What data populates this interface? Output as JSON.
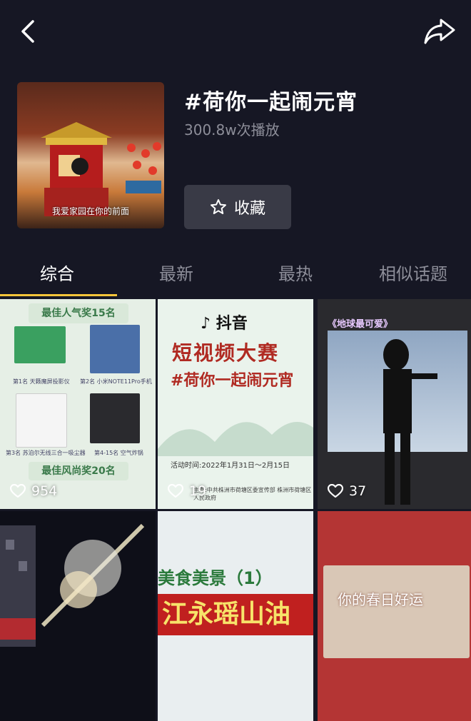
{
  "header": {
    "title": "#荷你一起闹元宵",
    "plays": "300.8w次播放",
    "cover_caption": "我爱家园在你的前面",
    "favorite_label": "收藏"
  },
  "icons": {
    "back": "chevron-left-icon",
    "share": "share-arrow-icon",
    "favorite": "star-outline-icon",
    "like": "heart-outline-icon"
  },
  "tabs": [
    {
      "label": "综合",
      "active": true
    },
    {
      "label": "最新",
      "active": false
    },
    {
      "label": "最热",
      "active": false
    },
    {
      "label": "相似话题",
      "active": false
    }
  ],
  "videos": [
    {
      "likes": "954",
      "banner_top": "最佳人气奖15名",
      "banner_bottom": "最佳风尚奖20名",
      "items": [
        "第1名 天籁魔屏投影仪",
        "第2名 小米NOTE11Pro手机",
        "第3名 苏泊尔无线三合一吸尘器",
        "第4-15名 空气炸锅"
      ]
    },
    {
      "likes": "19",
      "brand": "抖音",
      "contest": "短视频大赛",
      "topic": "#荷你一起闹元宵",
      "dates": "活动时间:2022年1月31日～2月15日",
      "organizer": "主办:中共株洲市荷塘区委宣传部 株洲市荷塘区人民政府"
    },
    {
      "likes": "37",
      "caption": "《地球最可爱》"
    },
    {
      "likes": ""
    },
    {
      "likes": "",
      "line1": "美食美景（1）",
      "line2": "江永瑶山油"
    },
    {
      "likes": "",
      "message": "你的春日好运"
    }
  ],
  "colors": {
    "background": "#161724",
    "accent_underline": "#f8c53a",
    "muted_text": "#8d8e99",
    "button_bg": "#393a46"
  }
}
